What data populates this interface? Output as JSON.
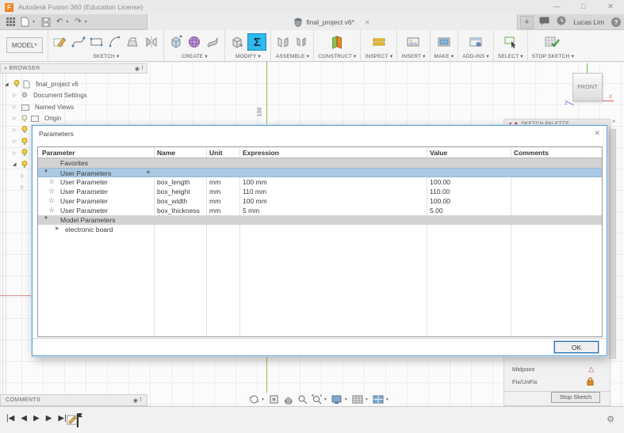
{
  "window": {
    "title": "Autodesk Fusion 360 (Education License)"
  },
  "tabbar": {
    "tab_label": "final_project v6*",
    "user_name": "Lucas Lim",
    "help_label": "?"
  },
  "toolbar": {
    "model_label": "MODEL",
    "groups": [
      "SKETCH",
      "CREATE",
      "MODIFY",
      "ASSEMBLE",
      "CONSTRUCT",
      "INSPECT",
      "INSERT",
      "MAKE",
      "ADD-INS",
      "SELECT",
      "STOP SKETCH"
    ]
  },
  "browser": {
    "title": "BROWSER",
    "items": [
      {
        "label": "final_project v6"
      },
      {
        "label": "Document Settings"
      },
      {
        "label": "Named Views"
      },
      {
        "label": "Origin"
      }
    ]
  },
  "canvas": {
    "dimension_label": "100",
    "viewcube_face": "FRONT",
    "axis_x_label": "X",
    "axis_z_label": "Z"
  },
  "sketch_palette": {
    "title": "SKETCH PALETTE",
    "options": [
      {
        "label": "Midpoint"
      },
      {
        "label": "Fix/UnFix"
      }
    ],
    "stop_sketch_label": "Stop Sketch"
  },
  "dialog": {
    "title": "Parameters",
    "columns": [
      "Parameter",
      "Name",
      "Unit",
      "Expression",
      "Value",
      "Comments"
    ],
    "favorites_label": "Favorites",
    "user_parameters_label": "User Parameters",
    "model_parameters_label": "Model Parameters",
    "user_rows": [
      {
        "parameter": "User Parameter",
        "name": "box_length",
        "unit": "mm",
        "expression": "100 mm",
        "value": "100.00",
        "comments": ""
      },
      {
        "parameter": "User Parameter",
        "name": "box_height",
        "unit": "mm",
        "expression": "110 mm",
        "value": "110.00",
        "comments": ""
      },
      {
        "parameter": "User Parameter",
        "name": "box_width",
        "unit": "mm",
        "expression": "100 mm",
        "value": "100.00",
        "comments": ""
      },
      {
        "parameter": "User Parameter",
        "name": "box_thickness",
        "unit": "mm",
        "expression": "5 mm",
        "value": "5.00",
        "comments": ""
      }
    ],
    "model_rows": [
      {
        "label": "electronic board"
      }
    ],
    "ok_label": "OK"
  },
  "bottom": {
    "comments_label": "COMMENTS"
  }
}
